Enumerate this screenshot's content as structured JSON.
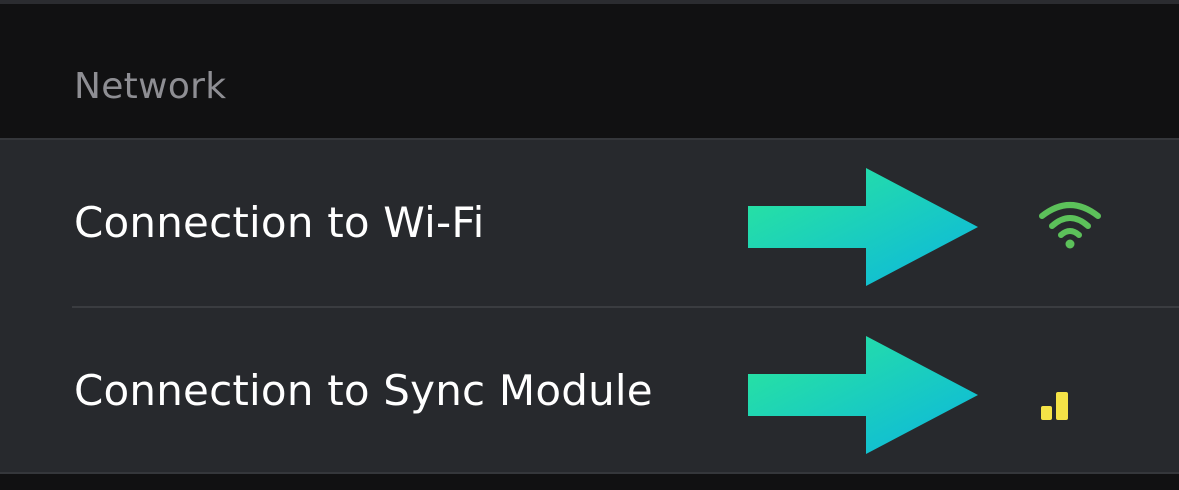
{
  "network_section": {
    "header": "Network",
    "rows": [
      {
        "label": "Connection to Wi-Fi",
        "status_icon": "wifi-signal-icon",
        "status_color": "#5cc15a"
      },
      {
        "label": "Connection to Sync Module",
        "status_icon": "cellular-signal-icon",
        "status_color": "#f5e347"
      }
    ]
  },
  "colors": {
    "arrow_gradient_start": "#2be89a",
    "arrow_gradient_end": "#0bb5e0"
  }
}
